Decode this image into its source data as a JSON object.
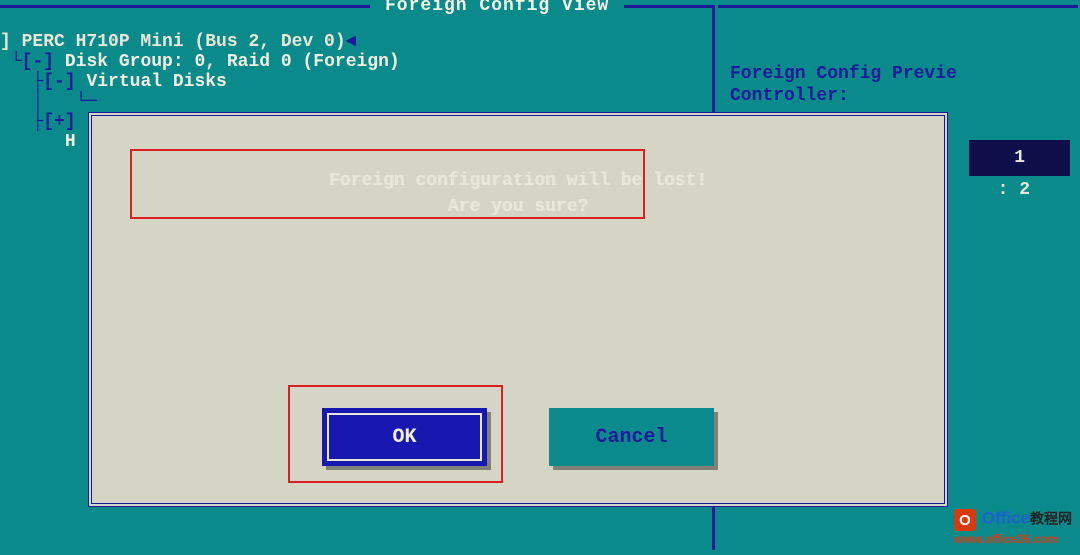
{
  "header": {
    "title": "Foreign Config View"
  },
  "tree": {
    "controller": "] PERC H710P Mini (Bus 2, Dev 0)",
    "disk_group": "Disk Group: 0, Raid 0 (Foreign)",
    "virtual_disks": "Virtual Disks",
    "collapsed_marker": "[+]",
    "expanded_marker": "[-]",
    "hd_prefix": "H"
  },
  "side": {
    "line1": "Foreign Config Previe",
    "line2": "Controller:",
    "num1": "1",
    "num2": ": 2"
  },
  "dialog": {
    "line1": "Foreign configuration will be lost!",
    "line2": "Are you sure?",
    "ok_label": "OK",
    "cancel_label": "Cancel"
  },
  "watermark": {
    "brand": "Office",
    "brand_cn": "教程网",
    "url": "www.office26.com"
  }
}
